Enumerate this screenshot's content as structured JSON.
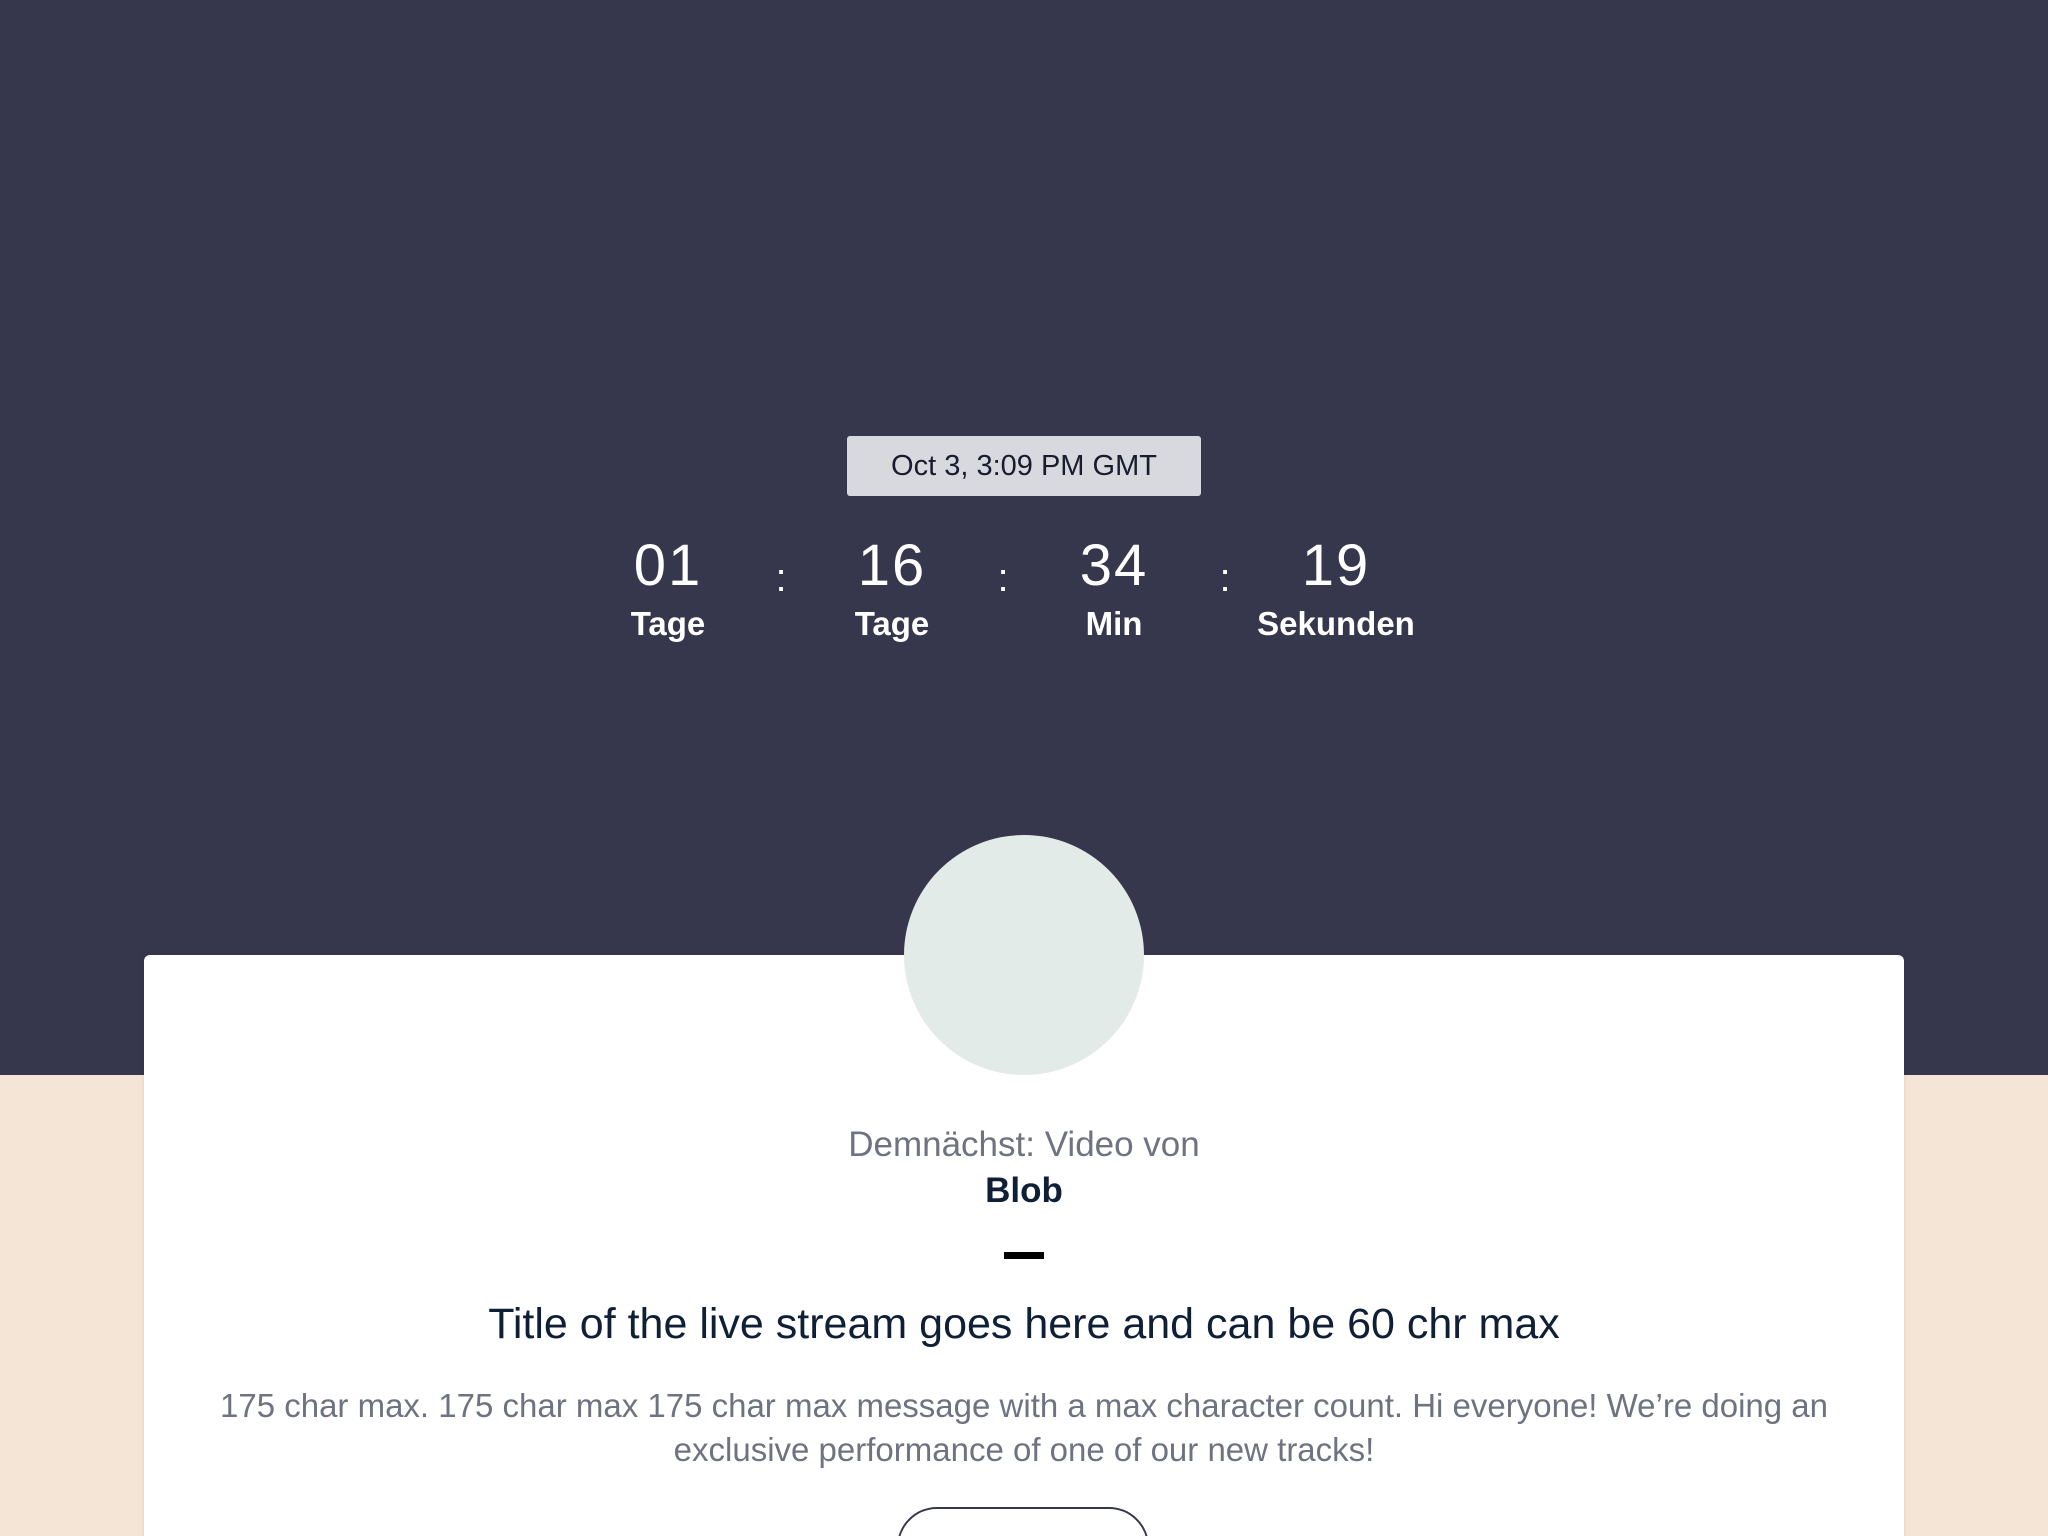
{
  "event": {
    "date_time": "Oct 3, 3:09 PM GMT"
  },
  "countdown": {
    "units": [
      {
        "value": "01",
        "label": "Tage"
      },
      {
        "value": "16",
        "label": "Tage"
      },
      {
        "value": "34",
        "label": "Min"
      },
      {
        "value": "19",
        "label": "Sekunden"
      }
    ],
    "separator": ":"
  },
  "card": {
    "upcoming_label": "Demnächst: Video von",
    "creator_name": "Blob",
    "stream_title": "Title of the live stream goes here and can be 60 chr max",
    "message": "175 char max. 175 char max 175 char max message with a max character count. Hi everyone! We’re doing an exclusive performance of one of our new tracks!"
  },
  "colors": {
    "hero_background": "#36374c",
    "page_background": "#f4e5d7",
    "card_background": "#ffffff",
    "badge_background": "#d8d9de",
    "avatar_placeholder": "#e3ebe8",
    "title_text": "#0f1f36",
    "muted_text": "#6f7281"
  }
}
